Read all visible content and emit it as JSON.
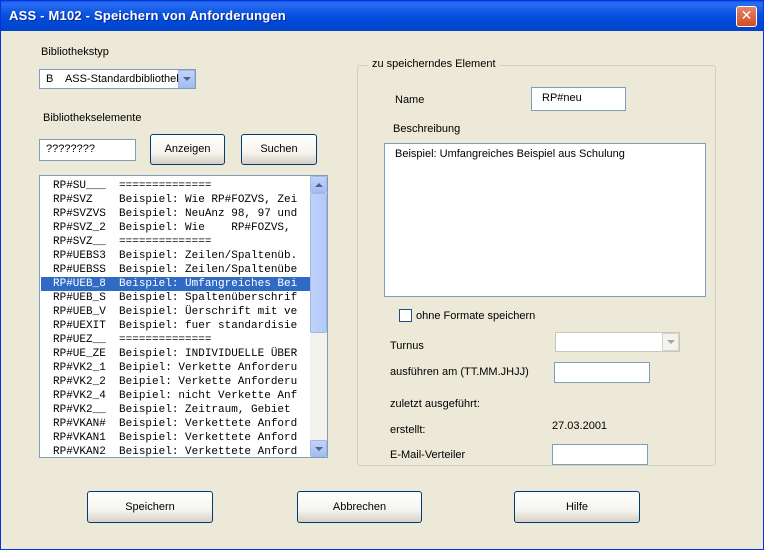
{
  "window": {
    "title": "ASS - M102 - Speichern von Anforderungen",
    "close_glyph": "✕"
  },
  "left": {
    "bibliothekstyp_label": "Bibliothekstyp",
    "bibliothekstyp_code": "B",
    "bibliothekstyp_value": "ASS-Standardbibliothek",
    "bibliothekselemente_label": "Bibliothekselemente",
    "search_value": "????????",
    "anzeigen_label": "Anzeigen",
    "suchen_label": "Suchen",
    "items": [
      "RP#SU___  ==============",
      "RP#SVZ    Beispiel: Wie RP#FOZVS, Zei",
      "RP#SVZVS  Beispiel: NeuAnz 98, 97 und",
      "RP#SVZ_2  Beispiel: Wie    RP#FOZVS,",
      "RP#SVZ__  ==============",
      "RP#UEBS3  Beispiel: Zeilen/Spaltenüb.",
      "RP#UEBSS  Beispiel: Zeilen/Spaltenübe",
      "RP#UEB_8  Beispiel: Umfangreiches Bei",
      "RP#UEB_S  Beispiel: Spaltenüberschrif",
      "RP#UEB_V  Beispiel: Üerschrift mit ve",
      "RP#UEXIT  Beispiel: fuer standardisie",
      "RP#UEZ__  ==============",
      "RP#UE_ZE  Beispiel: INDIVIDUELLE ÜBER",
      "RP#VK2_1  Beipiel: Verkette Anforderu",
      "RP#VK2_2  Beipiel: Verkette Anforderu",
      "RP#VK2_4  Beipiel: nicht Verkette Anf",
      "RP#VK2__  Beispiel: Zeitraum, Gebiet",
      "RP#VKAN#  Beispiel: Verkettete Anford",
      "RP#VKAN1  Beispiel: Verkettete Anford",
      "RP#VKAN2  Beispiel: Verkettete Anford"
    ],
    "selected_index": 7
  },
  "right": {
    "group_label": "zu speicherndes Element",
    "name_label": "Name",
    "name_value": "RP#neu",
    "beschreibung_label": "Beschreibung",
    "beschreibung_value": "Beispiel: Umfangreiches Beispiel aus Schulung",
    "ohne_formate_label": "ohne Formate speichern",
    "turnus_label": "Turnus",
    "turnus_value": "",
    "ausfuehren_label": "ausführen am  (TT.MM.JHJJ)",
    "ausfuehren_value": "",
    "zuletzt_label": "zuletzt ausgeführt:",
    "erstellt_label": "erstellt:",
    "erstellt_value": "27.03.2001",
    "email_label": "E-Mail-Verteiler",
    "email_value": ""
  },
  "buttons": {
    "speichern": "Speichern",
    "abbrechen": "Abbrechen",
    "hilfe": "Hilfe"
  }
}
